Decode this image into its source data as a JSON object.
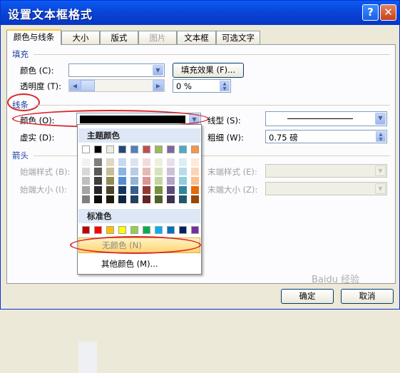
{
  "window": {
    "title": "设置文本框格式",
    "help": "?",
    "close": "✕"
  },
  "tabs": [
    {
      "label": "颜色与线条"
    },
    {
      "label": "大小"
    },
    {
      "label": "版式"
    },
    {
      "label": "图片"
    },
    {
      "label": "文本框"
    },
    {
      "label": "可选文字"
    }
  ],
  "fill": {
    "section": "填充",
    "color_label": "颜色 (C):",
    "effects_button": "填充效果 (F)...",
    "transparency_label": "透明度 (T):",
    "transparency_value": "0 %"
  },
  "line": {
    "section": "线条",
    "color_label": "颜色 (O):",
    "style_label": "线型 (S):",
    "dash_label": "虚实 (D):",
    "weight_label": "粗细 (W):",
    "weight_value": "0.75 磅"
  },
  "arrows": {
    "section": "箭头",
    "begin_style": "始端样式 (B):",
    "begin_size": "始端大小 (I):",
    "end_style": "末端样式 (E):",
    "end_size": "末端大小 (Z):"
  },
  "palette": {
    "theme_header": "主题颜色",
    "standard_header": "标准色",
    "no_color": "无颜色 (N)",
    "more_colors": "其他颜色 (M)...",
    "theme_top": [
      "#ffffff",
      "#000000",
      "#eeece1",
      "#1f497d",
      "#4f81bd",
      "#c0504d",
      "#9bbb59",
      "#8064a2",
      "#4bacc6",
      "#f79646"
    ],
    "theme_cols": [
      [
        "#f2f2f2",
        "#d8d8d8",
        "#bfbfbf",
        "#a5a5a5",
        "#7f7f7f"
      ],
      [
        "#7f7f7f",
        "#595959",
        "#3f3f3f",
        "#262626",
        "#0c0c0c"
      ],
      [
        "#ddd9c3",
        "#c4bd97",
        "#938953",
        "#494429",
        "#1d1b10"
      ],
      [
        "#c6d9f0",
        "#8db3e2",
        "#548dd4",
        "#17365d",
        "#0f243e"
      ],
      [
        "#dbe5f1",
        "#b8cce4",
        "#95b3d7",
        "#366092",
        "#244061"
      ],
      [
        "#f2dcdb",
        "#e5b9b7",
        "#d99694",
        "#953734",
        "#632423"
      ],
      [
        "#ebf1dd",
        "#d7e3bc",
        "#c3d69b",
        "#76923c",
        "#4f6128"
      ],
      [
        "#e5e0ec",
        "#ccc1d9",
        "#b2a2c7",
        "#5f497a",
        "#3f3151"
      ],
      [
        "#dbeef3",
        "#b7dde8",
        "#92cddc",
        "#31859b",
        "#205867"
      ],
      [
        "#fdeada",
        "#fbd5b5",
        "#fac08f",
        "#e36c09",
        "#974806"
      ]
    ],
    "standard": [
      "#c00000",
      "#ff0000",
      "#ffc000",
      "#ffff00",
      "#92d050",
      "#00b050",
      "#00b0f0",
      "#0070c0",
      "#002060",
      "#7030a0"
    ]
  },
  "buttons": {
    "ok": "确定",
    "cancel": "取消"
  },
  "colors": {
    "line_color": "#000000",
    "highlight_red": "#d8262a"
  },
  "watermark": "Baidu 经验"
}
